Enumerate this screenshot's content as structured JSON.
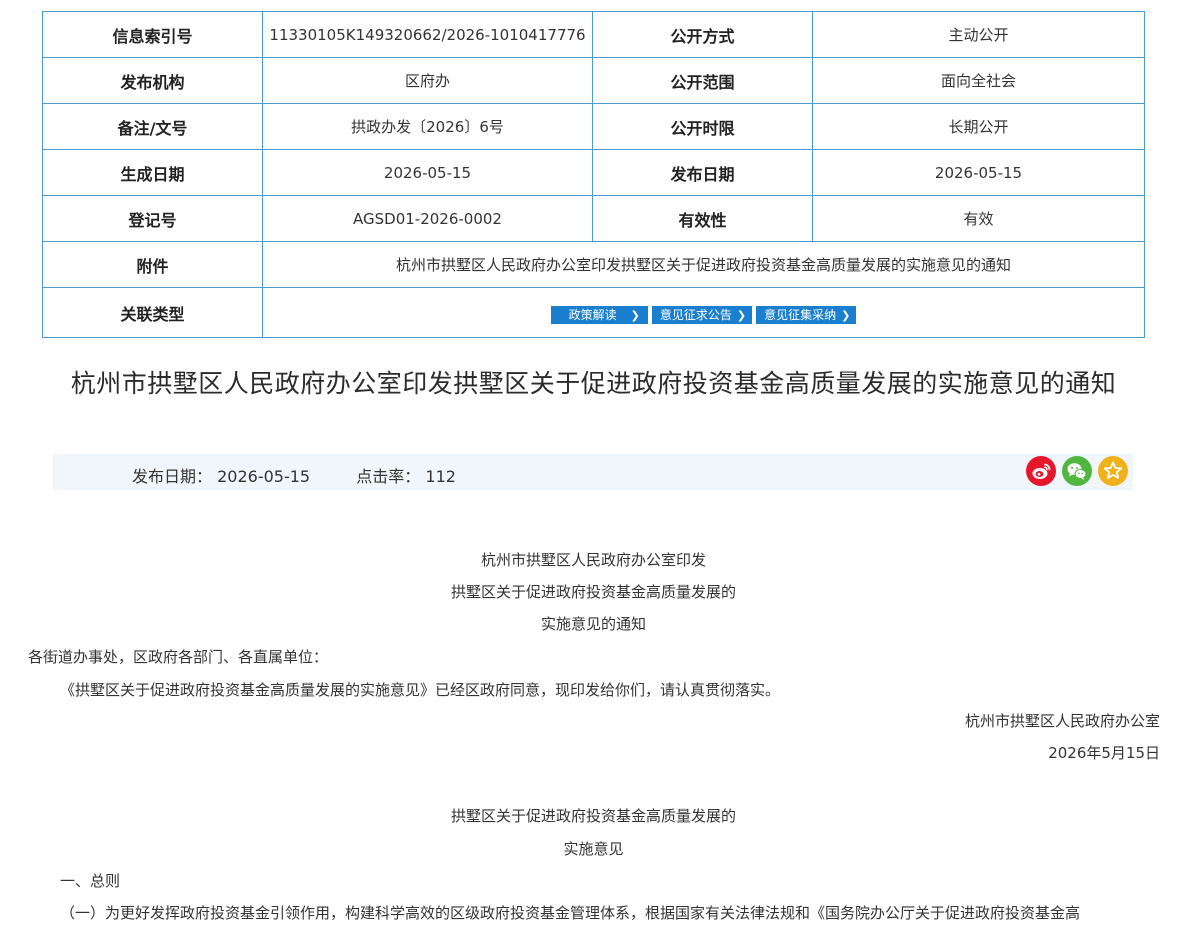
{
  "meta": {
    "index_no_label": "信息索引号",
    "index_no_value": "11330105K149320662/2026-1010417776",
    "open_method_label": "公开方式",
    "open_method_value": "主动公开",
    "publisher_label": "发布机构",
    "publisher_value": "区府办",
    "open_scope_label": "公开范围",
    "open_scope_value": "面向全社会",
    "doc_no_label": "备注/文号",
    "doc_no_value": "拱政办发〔2026〕6号",
    "open_period_label": "公开时限",
    "open_period_value": "长期公开",
    "created_date_label": "生成日期",
    "created_date_value": "2026-05-15",
    "publish_date_label": "发布日期",
    "publish_date_value": "2026-05-15",
    "reg_no_label": "登记号",
    "reg_no_value": "AGSD01-2026-0002",
    "validity_label": "有效性",
    "validity_value": "有效",
    "attachment_label": "附件",
    "attachment_value": "杭州市拱墅区人民政府办公室印发拱墅区关于促进政府投资基金高质量发展的实施意见的通知",
    "related_label": "关联类型",
    "related_tags": [
      "政策解读",
      "意见征求公告",
      "意见征集采纳"
    ]
  },
  "article": {
    "title": "杭州市拱墅区人民政府办公室印发拱墅区关于促进政府投资基金高质量发展的实施意见的通知",
    "publish_date_label": "发布日期：",
    "publish_date": "2026-05-15",
    "hits_label": "点击率：",
    "hits": "112",
    "heading_line1": "杭州市拱墅区人民政府办公室印发",
    "heading_line2": "拱墅区关于促进政府投资基金高质量发展的",
    "heading_line3": "实施意见的通知",
    "recipients": "各街道办事处，区政府各部门、各直属单位：",
    "body_p1": "《拱墅区关于促进政府投资基金高质量发展的实施意见》已经区政府同意，现印发给你们，请认真贯彻落实。",
    "signature": "杭州市拱墅区人民政府办公室",
    "sign_date": "2026年5月15日",
    "sub_title_line1": "拱墅区关于促进政府投资基金高质量发展的",
    "sub_title_line2": "实施意见",
    "section1": "一、总则",
    "section1_p1": "（一）为更好发挥政府投资基金引领作用，构建科学高效的区级政府投资基金管理体系，根据国家有关法律法规和《国务院办公厅关于促进政府投资基金高"
  },
  "share_icons": [
    "weibo-icon",
    "wechat-icon",
    "favorite-star-icon"
  ],
  "colors": {
    "table_border": "#4a9bd4",
    "tag_button": "#1b7fd0",
    "info_bar": "#f0f6fb",
    "weibo": "#e6162d",
    "wechat": "#50b63f",
    "favorite": "#f0b21b"
  }
}
